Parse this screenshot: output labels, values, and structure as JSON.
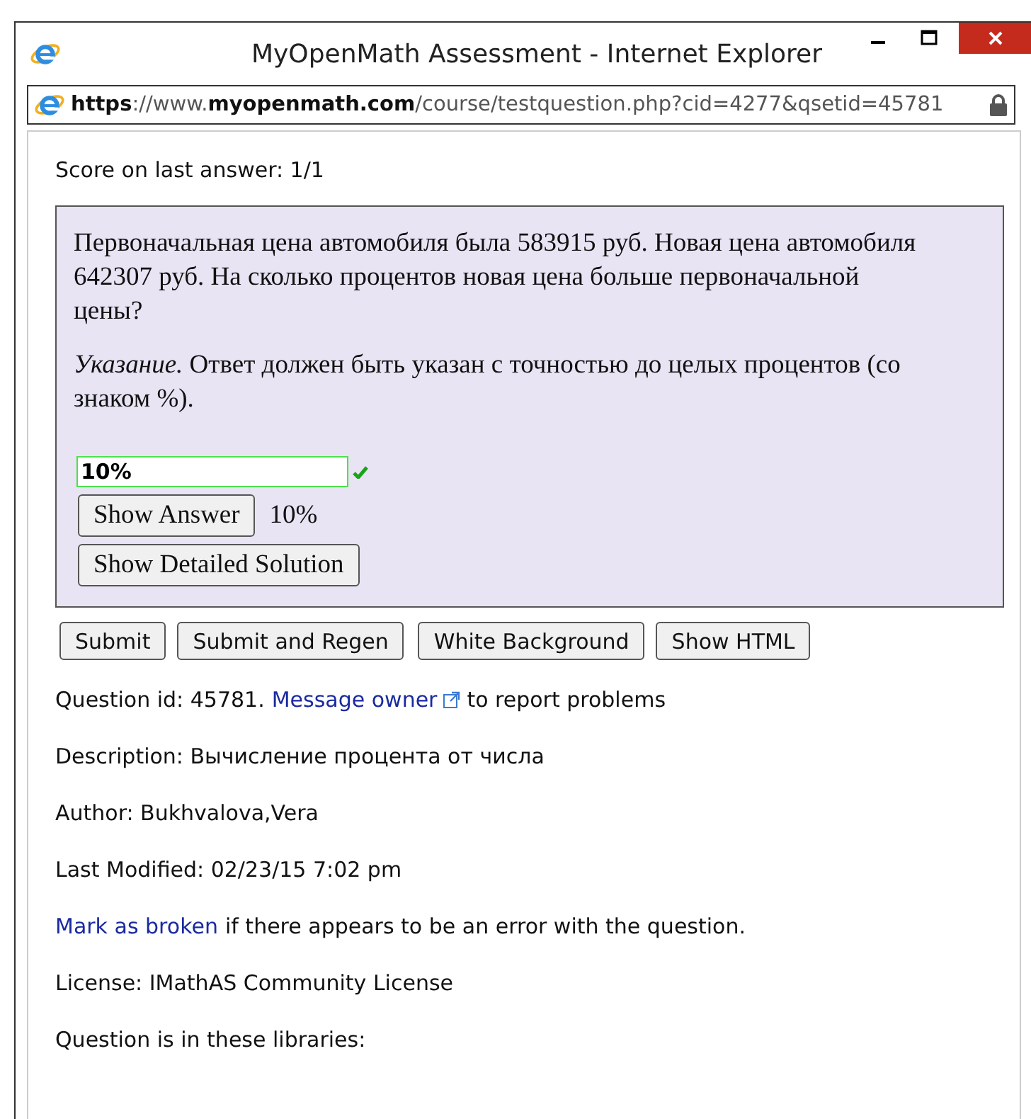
{
  "window": {
    "title": "MyOpenMath Assessment - Internet Explorer"
  },
  "address_bar": {
    "url": "**https**://www.**myopenmath.com**/course/testquestion.php?cid=4277&qsetid=45781",
    "secure": true
  },
  "score": "Score on last answer: 1/1",
  "question": {
    "paragraphs": [
      "Первоначальная цена автомобиля была 583915 руб. Новая цена автомобиля 642307 руб. На сколько процентов новая цена больше первоначальной цены?",
      "*Указание.* Ответ должен быть указан с точностью до целых процентов (со знаком %)."
    ],
    "answer": {
      "value": "10%",
      "correct": true
    },
    "show_answer_button": "Show Answer",
    "shown_answer": "10%",
    "solution_button": "Show Detailed Solution"
  },
  "buttons": [
    "Submit",
    "Submit and Regen",
    "White Background",
    "Show HTML"
  ],
  "info_lines": [
    {
      "segments": [
        {
          "kind": "text",
          "text": "Question id: 45781."
        },
        {
          "kind": "external_link",
          "text": "Message owner"
        },
        {
          "kind": "text",
          "text": "to report problems"
        }
      ]
    },
    {
      "segments": [
        {
          "kind": "text",
          "text": "Description: Вычисление процента от числа"
        }
      ]
    },
    {
      "segments": [
        {
          "kind": "text",
          "text": "Author: Bukhvalova,Vera"
        }
      ]
    },
    {
      "segments": [
        {
          "kind": "text",
          "text": "Last Modified: 02/23/15 7:02 pm"
        }
      ]
    },
    {
      "segments": [
        {
          "kind": "link",
          "text": "Mark as broken"
        },
        {
          "kind": "text",
          "text": "if there appears to be an error with the question."
        }
      ]
    },
    {
      "segments": [
        {
          "kind": "text",
          "text": "License: IMathAS Community License"
        }
      ]
    },
    {
      "segments": [
        {
          "kind": "text",
          "text": "Question is in these libraries:"
        }
      ]
    }
  ]
}
